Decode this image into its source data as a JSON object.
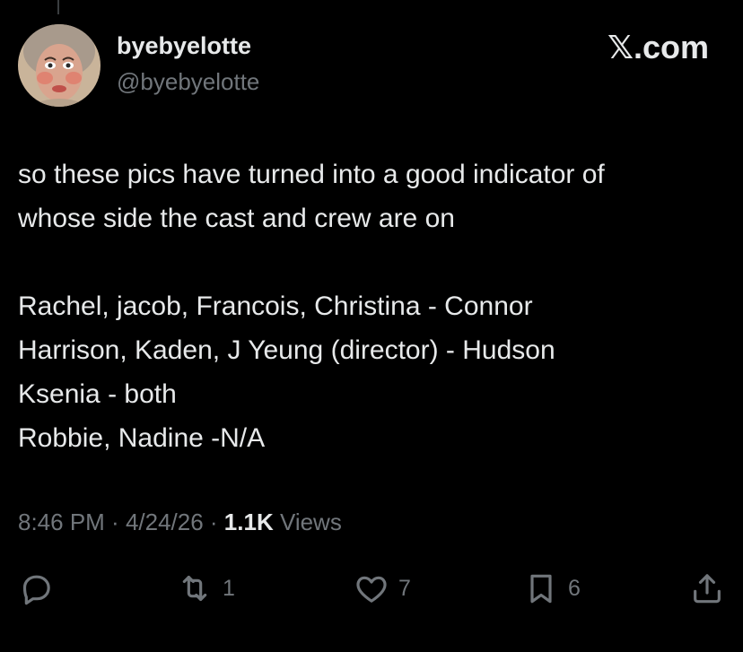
{
  "header": {
    "display_name": "byebyelotte",
    "handle": "@byebyelotte",
    "brand": "𝕏.com",
    "avatar_icon": "profile-avatar"
  },
  "tweet": {
    "lines": [
      "so these pics have turned into a good indicator of",
      "whose side the cast and crew are on",
      "",
      "Rachel, jacob, Francois, Christina - Connor",
      "Harrison, Kaden, J Yeung (director) - Hudson",
      "Ksenia - both",
      "Robbie, Nadine -N/A"
    ]
  },
  "meta": {
    "time": "8:46 PM",
    "separator": " · ",
    "date": "4/24/26",
    "views_count": "1.1K",
    "views_label": " Views"
  },
  "actions": {
    "reply": {
      "icon": "reply-icon",
      "count": ""
    },
    "retweet": {
      "icon": "retweet-icon",
      "count": "1"
    },
    "like": {
      "icon": "heart-icon",
      "count": "7"
    },
    "bookmark": {
      "icon": "bookmark-icon",
      "count": "6"
    },
    "share": {
      "icon": "share-icon",
      "count": ""
    }
  },
  "colors": {
    "background": "#000000",
    "primary_text": "#e7e9ea",
    "secondary_text": "#71767b"
  }
}
